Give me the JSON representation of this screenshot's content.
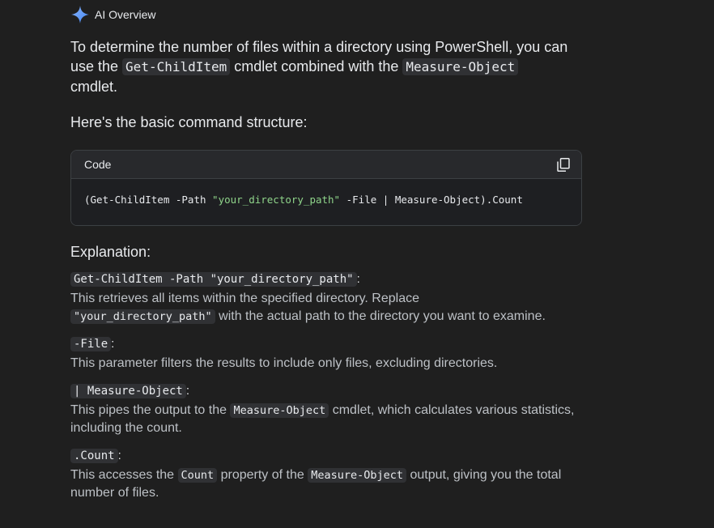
{
  "header": {
    "title": "AI Overview",
    "icon": "sparkle-icon",
    "accent_color": "#8ab4f8"
  },
  "intro": {
    "part1": "To determine the number of files within a directory using PowerShell, you can use the ",
    "code1": "Get-ChildItem",
    "part2": " cmdlet combined with the ",
    "code2": "Measure-Object",
    "part3": " cmdlet."
  },
  "structure_heading": "Here's the basic command structure:",
  "codebox": {
    "label": "Code",
    "copy_icon": "copy-icon",
    "code_pre": "(Get-ChildItem -Path ",
    "code_string": "\"your_directory_path\"",
    "code_post": " -File | Measure-Object).Count"
  },
  "explanation_heading": "Explanation:",
  "explanations": [
    {
      "term": "Get-ChildItem -Path \"your_directory_path\"",
      "desc_pre": "This retrieves all items within the specified directory. Replace ",
      "desc_code": "\"your_directory_path\"",
      "desc_post": " with the actual path to the directory you want to examine."
    },
    {
      "term": "-File",
      "desc": "This parameter filters the results to include only files, excluding directories."
    },
    {
      "term": "| Measure-Object",
      "desc_pre": "This pipes the output to the ",
      "desc_code": "Measure-Object",
      "desc_post": " cmdlet, which calculates various statistics, including the count."
    },
    {
      "term": ".Count",
      "desc_pre": "This accesses the ",
      "desc_code": "Count",
      "desc_mid": " property of the ",
      "desc_code2": "Measure-Object",
      "desc_post": " output, giving you the total number of files."
    }
  ]
}
